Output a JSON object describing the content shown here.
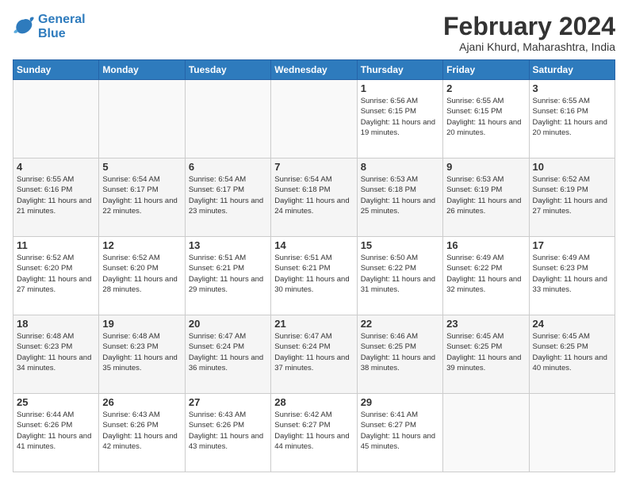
{
  "logo": {
    "line1": "General",
    "line2": "Blue"
  },
  "title": "February 2024",
  "subtitle": "Ajani Khurd, Maharashtra, India",
  "weekdays": [
    "Sunday",
    "Monday",
    "Tuesday",
    "Wednesday",
    "Thursday",
    "Friday",
    "Saturday"
  ],
  "weeks": [
    [
      {
        "day": "",
        "info": ""
      },
      {
        "day": "",
        "info": ""
      },
      {
        "day": "",
        "info": ""
      },
      {
        "day": "",
        "info": ""
      },
      {
        "day": "1",
        "info": "Sunrise: 6:56 AM\nSunset: 6:15 PM\nDaylight: 11 hours and 19 minutes."
      },
      {
        "day": "2",
        "info": "Sunrise: 6:55 AM\nSunset: 6:15 PM\nDaylight: 11 hours and 20 minutes."
      },
      {
        "day": "3",
        "info": "Sunrise: 6:55 AM\nSunset: 6:16 PM\nDaylight: 11 hours and 20 minutes."
      }
    ],
    [
      {
        "day": "4",
        "info": "Sunrise: 6:55 AM\nSunset: 6:16 PM\nDaylight: 11 hours and 21 minutes."
      },
      {
        "day": "5",
        "info": "Sunrise: 6:54 AM\nSunset: 6:17 PM\nDaylight: 11 hours and 22 minutes."
      },
      {
        "day": "6",
        "info": "Sunrise: 6:54 AM\nSunset: 6:17 PM\nDaylight: 11 hours and 23 minutes."
      },
      {
        "day": "7",
        "info": "Sunrise: 6:54 AM\nSunset: 6:18 PM\nDaylight: 11 hours and 24 minutes."
      },
      {
        "day": "8",
        "info": "Sunrise: 6:53 AM\nSunset: 6:18 PM\nDaylight: 11 hours and 25 minutes."
      },
      {
        "day": "9",
        "info": "Sunrise: 6:53 AM\nSunset: 6:19 PM\nDaylight: 11 hours and 26 minutes."
      },
      {
        "day": "10",
        "info": "Sunrise: 6:52 AM\nSunset: 6:19 PM\nDaylight: 11 hours and 27 minutes."
      }
    ],
    [
      {
        "day": "11",
        "info": "Sunrise: 6:52 AM\nSunset: 6:20 PM\nDaylight: 11 hours and 27 minutes."
      },
      {
        "day": "12",
        "info": "Sunrise: 6:52 AM\nSunset: 6:20 PM\nDaylight: 11 hours and 28 minutes."
      },
      {
        "day": "13",
        "info": "Sunrise: 6:51 AM\nSunset: 6:21 PM\nDaylight: 11 hours and 29 minutes."
      },
      {
        "day": "14",
        "info": "Sunrise: 6:51 AM\nSunset: 6:21 PM\nDaylight: 11 hours and 30 minutes."
      },
      {
        "day": "15",
        "info": "Sunrise: 6:50 AM\nSunset: 6:22 PM\nDaylight: 11 hours and 31 minutes."
      },
      {
        "day": "16",
        "info": "Sunrise: 6:49 AM\nSunset: 6:22 PM\nDaylight: 11 hours and 32 minutes."
      },
      {
        "day": "17",
        "info": "Sunrise: 6:49 AM\nSunset: 6:23 PM\nDaylight: 11 hours and 33 minutes."
      }
    ],
    [
      {
        "day": "18",
        "info": "Sunrise: 6:48 AM\nSunset: 6:23 PM\nDaylight: 11 hours and 34 minutes."
      },
      {
        "day": "19",
        "info": "Sunrise: 6:48 AM\nSunset: 6:23 PM\nDaylight: 11 hours and 35 minutes."
      },
      {
        "day": "20",
        "info": "Sunrise: 6:47 AM\nSunset: 6:24 PM\nDaylight: 11 hours and 36 minutes."
      },
      {
        "day": "21",
        "info": "Sunrise: 6:47 AM\nSunset: 6:24 PM\nDaylight: 11 hours and 37 minutes."
      },
      {
        "day": "22",
        "info": "Sunrise: 6:46 AM\nSunset: 6:25 PM\nDaylight: 11 hours and 38 minutes."
      },
      {
        "day": "23",
        "info": "Sunrise: 6:45 AM\nSunset: 6:25 PM\nDaylight: 11 hours and 39 minutes."
      },
      {
        "day": "24",
        "info": "Sunrise: 6:45 AM\nSunset: 6:25 PM\nDaylight: 11 hours and 40 minutes."
      }
    ],
    [
      {
        "day": "25",
        "info": "Sunrise: 6:44 AM\nSunset: 6:26 PM\nDaylight: 11 hours and 41 minutes."
      },
      {
        "day": "26",
        "info": "Sunrise: 6:43 AM\nSunset: 6:26 PM\nDaylight: 11 hours and 42 minutes."
      },
      {
        "day": "27",
        "info": "Sunrise: 6:43 AM\nSunset: 6:26 PM\nDaylight: 11 hours and 43 minutes."
      },
      {
        "day": "28",
        "info": "Sunrise: 6:42 AM\nSunset: 6:27 PM\nDaylight: 11 hours and 44 minutes."
      },
      {
        "day": "29",
        "info": "Sunrise: 6:41 AM\nSunset: 6:27 PM\nDaylight: 11 hours and 45 minutes."
      },
      {
        "day": "",
        "info": ""
      },
      {
        "day": "",
        "info": ""
      }
    ]
  ]
}
